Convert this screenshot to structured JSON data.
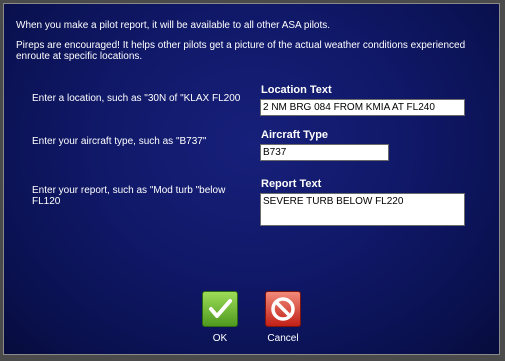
{
  "info": {
    "line1": "When you make a pilot report, it will be available to all other ASA pilots.",
    "line2": "Pireps are encouraged!  It helps other pilots get a picture of the actual weather conditions experienced enroute at specific locations."
  },
  "location": {
    "prompt": "Enter a location, such as \"30N of \"KLAX FL200",
    "label": "Location Text",
    "value": "2 NM BRG 084 FROM KMIA AT FL240"
  },
  "aircraft": {
    "prompt": "Enter your aircraft type, such as \"B737\"",
    "label": "Aircraft Type",
    "value": "B737"
  },
  "report": {
    "prompt": "Enter your report, such as \"Mod turb \"below FL120",
    "label": "Report Text",
    "value": "SEVERE TURB BELOW FL220"
  },
  "buttons": {
    "ok_label": "OK",
    "ok_icon": "checkmark-icon",
    "cancel_label": "Cancel",
    "cancel_icon": "no-entry-icon"
  },
  "colors": {
    "background": "#101868",
    "ok_green": "#6fbf34",
    "cancel_red": "#d83a2c"
  }
}
